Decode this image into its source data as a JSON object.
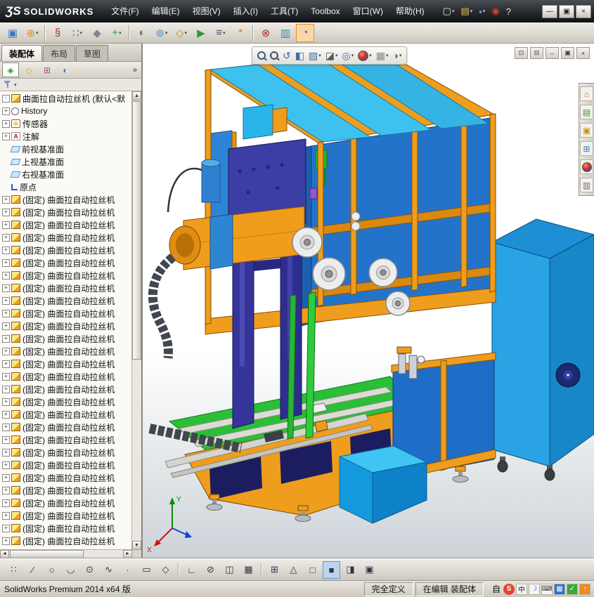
{
  "colors": {
    "accent_orange": "#f09c1c",
    "machine_blue": "#2273cb",
    "machine_cyan": "#3ec1ee",
    "machine_green": "#2abf37",
    "machine_navy": "#34349a",
    "cabinet_blue": "#2aa3e4",
    "titlebar_bg": "#26292d",
    "toolbar_bg": "#d6d2c8"
  },
  "titlebar": {
    "logo_glyph": "ƷS",
    "brand": "SOLIDWORKS",
    "menus": [
      "文件(F)",
      "编辑(E)",
      "视图(V)",
      "插入(I)",
      "工具(T)",
      "Toolbox",
      "窗口(W)",
      "帮助(H)"
    ],
    "quick_icons": [
      {
        "name": "new-document-icon",
        "glyph": "▢",
        "color": "#e8e8e8",
        "dropdown": true
      },
      {
        "name": "open-document-icon",
        "glyph": "▤",
        "color": "#f0c050",
        "dropdown": true
      },
      {
        "name": "save-document-icon",
        "glyph": "▪",
        "color": "#6aa0dc",
        "dropdown": true
      },
      {
        "name": "options-icon",
        "glyph": "◉",
        "color": "#cc4433",
        "dropdown": false
      },
      {
        "name": "help-icon",
        "glyph": "?",
        "color": "#e8e8e8",
        "dropdown": false
      }
    ],
    "window_buttons": [
      {
        "name": "minimize-button",
        "glyph": "—"
      },
      {
        "name": "restore-button",
        "glyph": "▣"
      },
      {
        "name": "close-button",
        "glyph": "×"
      }
    ]
  },
  "main_toolbar": {
    "icons": [
      {
        "name": "edit-component-icon",
        "glyph": "▣",
        "color": "#3a7ac0"
      },
      {
        "name": "insert-component-icon",
        "glyph": "⊕",
        "color": "#e09020",
        "dropdown": true
      },
      {
        "sep": true
      },
      {
        "name": "mate-icon",
        "glyph": "§",
        "color": "#b03030"
      },
      {
        "name": "component-pattern-icon",
        "glyph": "∷",
        "color": "#3a7ac0",
        "dropdown": true
      },
      {
        "name": "smart-fasteners-icon",
        "glyph": "◆",
        "color": "#808890"
      },
      {
        "name": "move-component-icon",
        "glyph": "+",
        "color": "#2f9a2f",
        "dropdown": true
      },
      {
        "sep": true
      },
      {
        "name": "show-hidden-components-icon",
        "glyph": "◐",
        "color": "#707070"
      },
      {
        "name": "assembly-features-icon",
        "glyph": "⊚",
        "color": "#4a8ad0",
        "dropdown": true
      },
      {
        "name": "reference-geometry-icon",
        "glyph": "◇",
        "color": "#c89018",
        "dropdown": true
      },
      {
        "name": "motion-study-icon",
        "glyph": "▶",
        "color": "#2f9a2f"
      },
      {
        "name": "bom-icon",
        "glyph": "≡",
        "color": "#555566",
        "dropdown": true
      },
      {
        "name": "exploded-view-icon",
        "glyph": "*",
        "color": "#e07020"
      },
      {
        "sep": true
      },
      {
        "name": "interference-detection-icon",
        "glyph": "⊗",
        "color": "#b03030"
      },
      {
        "name": "assembly-visualization-icon",
        "glyph": "▥",
        "color": "#2f8aa8"
      },
      {
        "name": "performance-evaluation-icon",
        "glyph": "◔",
        "color": "#7a50b0",
        "active": true
      }
    ]
  },
  "command_tabs": [
    {
      "label": "装配体",
      "active": true
    },
    {
      "label": "布局",
      "active": false
    },
    {
      "label": "草图",
      "active": false
    }
  ],
  "feature_panel": {
    "pane_tabs": [
      {
        "name": "featuremanager-tab-icon",
        "glyph": "◈",
        "color": "#2a9a2a",
        "active": true
      },
      {
        "name": "propertymanager-tab-icon",
        "glyph": "◇",
        "color": "#d0a020",
        "active": false
      },
      {
        "name": "configurationmanager-tab-icon",
        "glyph": "⊞",
        "color": "#b05090",
        "active": false
      },
      {
        "name": "displaymanager-tab-icon",
        "glyph": "◐",
        "color": "#3a7ac0",
        "active": false
      }
    ],
    "overflow_glyph": "»",
    "tree": {
      "root": {
        "label": "曲面拉自动拉丝机 (默认<默",
        "icon": "assembly-icon",
        "expander": "-"
      },
      "items": [
        {
          "label": "History",
          "icon": "history-icon",
          "expander": "+"
        },
        {
          "label": "传感器",
          "icon": "sensors-icon",
          "expander": "+"
        },
        {
          "label": "注解",
          "icon": "annotations-icon",
          "glyph": "A",
          "expander": "+"
        },
        {
          "label": "前视基准面",
          "icon": "plane-icon"
        },
        {
          "label": "上视基准面",
          "icon": "plane-icon"
        },
        {
          "label": "右视基准面",
          "icon": "plane-icon"
        },
        {
          "label": "原点",
          "icon": "origin-icon"
        }
      ],
      "fixed_item_label": "(固定) 曲面拉自动拉丝机",
      "fixed_item_icon": "assembly-icon",
      "fixed_item_expander": "+",
      "fixed_item_count": 28
    }
  },
  "viewport": {
    "heads_up": [
      {
        "name": "zoom-fit-icon",
        "kind": "mag"
      },
      {
        "name": "zoom-area-icon",
        "kind": "magbox"
      },
      {
        "name": "previous-view-icon",
        "glyph": "↺",
        "color": "#3a6ea5"
      },
      {
        "name": "section-view-icon",
        "glyph": "◧",
        "color": "#3a6ea5"
      },
      {
        "name": "view-orientation-icon",
        "glyph": "▧",
        "color": "#3a6ea5",
        "dropdown": true
      },
      {
        "name": "display-style-icon",
        "glyph": "◪",
        "color": "#556",
        "dropdown": true
      },
      {
        "name": "hide-show-items-icon",
        "glyph": "◎",
        "color": "#3a6ea5",
        "dropdown": true
      },
      {
        "name": "edit-appearance-icon",
        "kind": "ball",
        "dropdown": true
      },
      {
        "name": "apply-scene-icon",
        "glyph": "▦",
        "color": "#888",
        "dropdown": true
      },
      {
        "name": "view-settings-icon",
        "glyph": "◑",
        "color": "#3a6ea5",
        "dropdown": true
      }
    ],
    "window_controls": [
      {
        "name": "viewport-pin-icon",
        "glyph": "⊡"
      },
      {
        "name": "viewport-split-icon",
        "glyph": "⊟"
      },
      {
        "name": "viewport-minimize-icon",
        "glyph": "–"
      },
      {
        "name": "viewport-restore-icon",
        "glyph": "▣"
      },
      {
        "name": "viewport-close-icon",
        "glyph": "×"
      }
    ],
    "triad": {
      "x_label": "X",
      "y_label": "Y"
    }
  },
  "task_pane": [
    {
      "name": "resources-tab-icon",
      "glyph": "⌂",
      "color": "#d07020"
    },
    {
      "name": "design-library-tab-icon",
      "glyph": "▤",
      "color": "#2f9a2f"
    },
    {
      "name": "file-explorer-tab-icon",
      "glyph": "▣",
      "color": "#c89018"
    },
    {
      "name": "view-palette-tab-icon",
      "glyph": "⊞",
      "color": "#3a7ac0"
    },
    {
      "name": "appearances-tab-icon",
      "kind": "ball"
    },
    {
      "name": "custom-properties-tab-icon",
      "glyph": "▥",
      "color": "#707070"
    }
  ],
  "sketch_toolbar": [
    {
      "name": "quick-snaps-icon",
      "glyph": "∷"
    },
    {
      "name": "line-tool-icon",
      "glyph": "∕"
    },
    {
      "name": "circle-tool-icon",
      "glyph": "○"
    },
    {
      "name": "arc-tool-icon",
      "glyph": "◡"
    },
    {
      "name": "ellipse-tool-icon",
      "glyph": "⊙"
    },
    {
      "name": "spline-tool-icon",
      "glyph": "∿"
    },
    {
      "name": "point-tool-icon",
      "glyph": "·"
    },
    {
      "name": "rectangle-tool-icon",
      "glyph": "▭"
    },
    {
      "name": "polygon-tool-icon",
      "glyph": "◇"
    },
    {
      "sep": true
    },
    {
      "name": "fillet-tool-icon",
      "glyph": "∟"
    },
    {
      "name": "trim-tool-icon",
      "glyph": "⊘"
    },
    {
      "name": "mirror-tool-icon",
      "glyph": "◫"
    },
    {
      "name": "pattern-tool-icon",
      "glyph": "▦"
    },
    {
      "sep": true
    },
    {
      "name": "grid-toggle-icon",
      "glyph": "⊞"
    },
    {
      "name": "instant3d-icon",
      "glyph": "△"
    },
    {
      "name": "wireframe-view-icon",
      "glyph": "□"
    },
    {
      "name": "shaded-view-icon",
      "glyph": "■",
      "active": true
    },
    {
      "name": "section-toggle-icon",
      "glyph": "◨"
    },
    {
      "name": "split-view-icon",
      "glyph": "▣"
    }
  ],
  "statusbar": {
    "left_text": "SolidWorks Premium 2014 x64 版",
    "define_state": "完全定义",
    "edit_state": "在编辑 装配体",
    "ime_prefix": "自",
    "tray": [
      {
        "name": "ime-logo-icon",
        "glyph": "S",
        "bg": "#e8432d",
        "fg": "#ffffff",
        "round": true
      },
      {
        "name": "ime-lang-icon",
        "glyph": "中",
        "bg": "#f5f5f5",
        "fg": "#222222"
      },
      {
        "name": "ime-halfshape-icon",
        "glyph": "☽",
        "bg": "#f5f5f5",
        "fg": "#2b6fd4"
      },
      {
        "name": "ime-keyboard-icon",
        "glyph": "⌨",
        "bg": "#f5f5f5",
        "fg": "#333333"
      },
      {
        "name": "tray-display-icon",
        "glyph": "▦",
        "bg": "#2b6fd4",
        "fg": "#ffffff"
      },
      {
        "name": "tray-safety-icon",
        "glyph": "✓",
        "bg": "#3aa83a",
        "fg": "#ffffff"
      },
      {
        "name": "tray-update-icon",
        "glyph": "↑",
        "bg": "#f08a1e",
        "fg": "#ffffff"
      }
    ]
  }
}
